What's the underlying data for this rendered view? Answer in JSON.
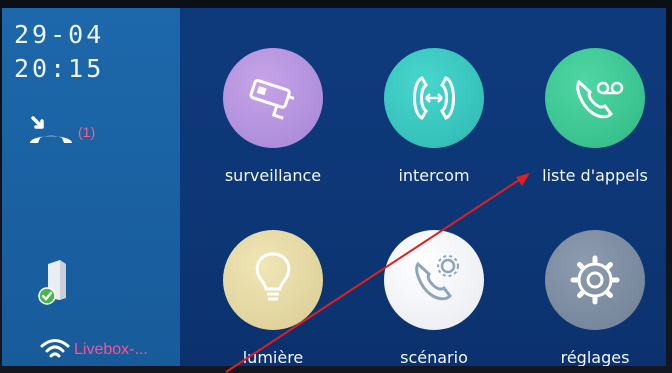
{
  "status": {
    "date": "29-04",
    "time": "20:15",
    "missed_calls": "(1)",
    "wifi_ssid": "Livebox-..."
  },
  "icons": {
    "missed_call": "missed-call-icon",
    "door": "door-status-icon",
    "wifi": "wifi-icon"
  },
  "tiles": [
    {
      "label": "surveillance",
      "icon": "cctv-camera-icon",
      "color": "#b48ed8"
    },
    {
      "label": "intercom",
      "icon": "intercom-handset-icon",
      "color": "#39c7c0"
    },
    {
      "label": "liste d'appels",
      "icon": "call-log-icon",
      "color": "#3dc796"
    },
    {
      "label": "lumière",
      "icon": "light-bulb-icon",
      "color": "#e8dca4"
    },
    {
      "label": "scénario",
      "icon": "scenario-phone-gear-icon",
      "color": "#f3f5f8"
    },
    {
      "label": "réglages",
      "icon": "settings-gear-icon",
      "color": "#7d8da3"
    }
  ],
  "colors": {
    "sidebar": "#1a62a3",
    "main": "#0d3777",
    "accent_text": "#ff4f97",
    "annotation_arrow": "#e0201e"
  }
}
